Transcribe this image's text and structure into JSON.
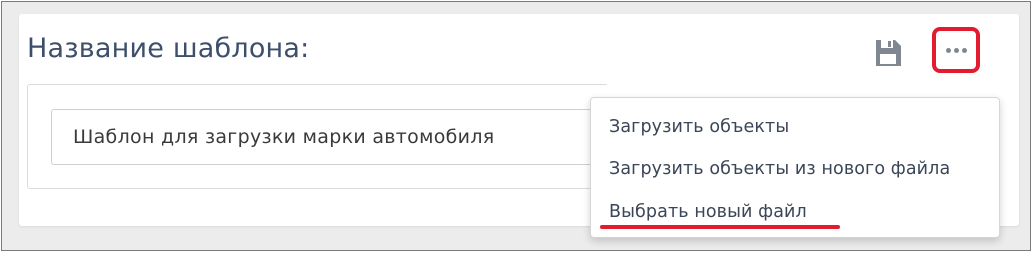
{
  "template": {
    "title": "Название шаблона:",
    "name_value": "Шаблон для загрузки марки автомобиля"
  },
  "toolbar": {
    "save_icon": "floppy-disk-icon",
    "more_icon": "ellipsis-icon"
  },
  "menu": {
    "items": [
      {
        "label": "Загрузить объекты"
      },
      {
        "label": "Загрузить объекты из нового файла"
      },
      {
        "label": "Выбрать новый файл"
      }
    ]
  },
  "colors": {
    "highlight": "#e31b2e",
    "title_text": "#3d4f6b",
    "icon_gray": "#7f8791"
  }
}
